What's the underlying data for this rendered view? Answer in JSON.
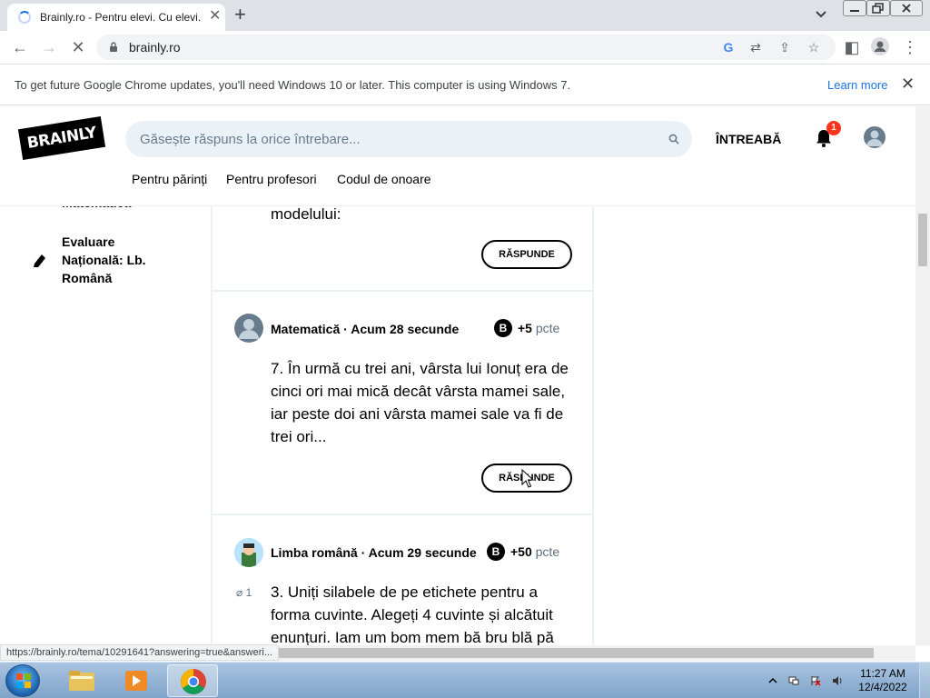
{
  "browser": {
    "tab_title": "Brainly.ro - Pentru elevi. Cu elevi.",
    "url": "brainly.ro",
    "info_bar_text": "To get future Google Chrome updates, you'll need Windows 10 or later. This computer is using Windows 7.",
    "learn_more": "Learn more",
    "status_url": "https://brainly.ro/tema/10291641?answering=true&answeri..."
  },
  "brainly": {
    "logo_text": "BRAINLY",
    "search_placeholder": "Găsește răspuns la orice întrebare...",
    "ask_label": "ÎNTREABĂ",
    "notification_count": "1",
    "subnav": [
      "Pentru părinți",
      "Pentru profesori",
      "Codul de onoare"
    ]
  },
  "sidebar": {
    "cut_item": "Matematică",
    "item_label": "Evaluare Națională: Lb. Română"
  },
  "feed": {
    "first_card_tail": "modelului:",
    "answer_label": "RĂSPUNDE",
    "questions": [
      {
        "subject": "Matematică",
        "separator": "·",
        "time": "Acum 28 secunde",
        "points": "+5",
        "points_unit": "pcte",
        "text": "7. În urmă cu trei ani, vârsta lui Ionuț era de cinci ori mai mică decât vârsta mamei sale, iar peste doi ani vârsta mamei sale va fi de trei ori..."
      },
      {
        "subject": "Limba română",
        "separator": "·",
        "time": "Acum 29 secunde",
        "points": "+50",
        "points_unit": "pcte",
        "attachments": "1",
        "text": "3. Uniți silabele de pe etichete pentru a forma cuvinte. Alegeți 4 cuvinte și alcătuit enunțuri. Iam um bom mem bă bru blă pă"
      }
    ]
  },
  "taskbar": {
    "time": "11:27 AM",
    "date": "12/4/2022"
  }
}
